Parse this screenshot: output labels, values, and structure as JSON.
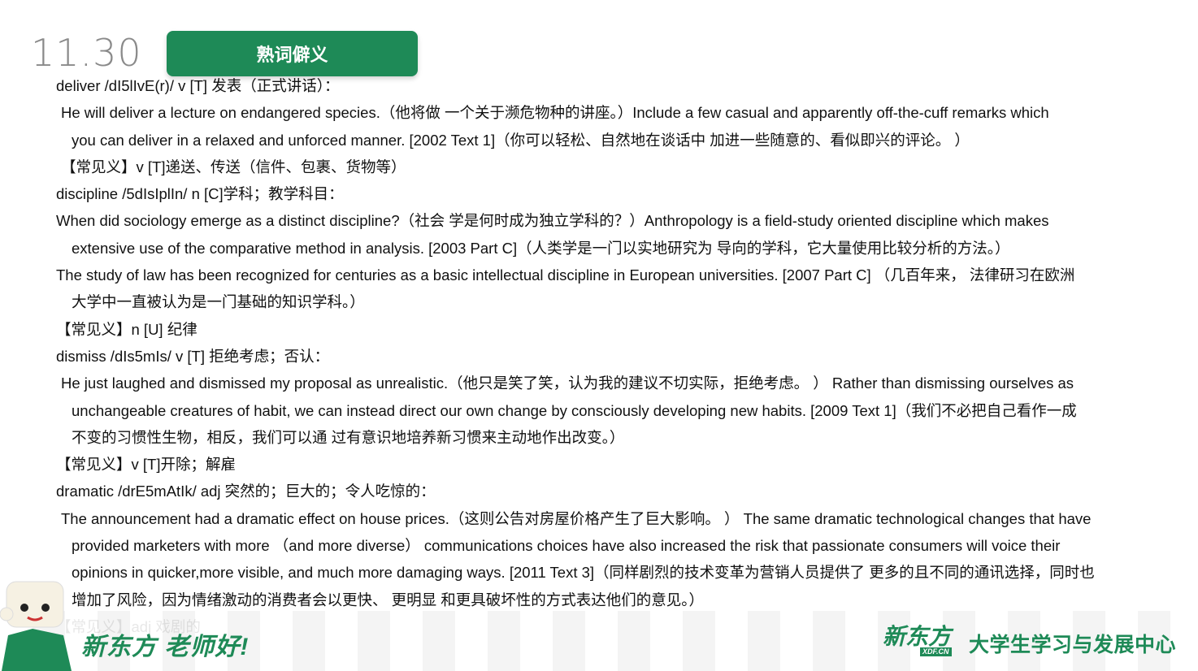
{
  "date": "11.30",
  "tag": "熟词僻义",
  "lines": [
    {
      "text": "deliver /dI5lIvE(r)/ v [T] 发表（正式讲话）：",
      "indent": 0
    },
    {
      "text": "He will deliver a lecture on endangered species.（他将做 一个关于濒危物种的讲座。）Include a few casual and apparently off-the-cuff remarks which",
      "indent": 1
    },
    {
      "text": "you can deliver in a relaxed and unforced manner. [2002 Text 1]（你可以轻松、自然地在谈话中 加进一些随意的、看似即兴的评论。 ）",
      "indent": 2
    },
    {
      "text": "【常见义】v [T]递送、传送（信件、包裹、货物等）",
      "indent": 1
    },
    {
      "text": "discipline /5dIsIplIn/ n [C]学科；教学科目：",
      "indent": 0
    },
    {
      "text": "When did sociology emerge as a distinct discipline?（社会 学是何时成为独立学科的？）Anthropology is a field-study oriented discipline which makes",
      "indent": 0
    },
    {
      "text": "extensive use of the comparative method in analysis. [2003 Part C]（人类学是一门以实地研究为 导向的学科，它大量使用比较分析的方法。）",
      "indent": 2
    },
    {
      "text": "The study of law has been recognized for centuries as a basic intellectual discipline in European universities. [2007 Part C] （几百年来， 法律研习在欧洲",
      "indent": 0
    },
    {
      "text": "大学中一直被认为是一门基础的知识学科。）",
      "indent": 2
    },
    {
      "text": "【常见义】n [U] 纪律",
      "indent": 0
    },
    {
      "text": "dismiss /dIs5mIs/ v [T] 拒绝考虑；否认：",
      "indent": 0
    },
    {
      "text": "He just laughed and dismissed my proposal as unrealistic.（他只是笑了笑，认为我的建议不切实际，拒绝考虑。 ） Rather than dismissing ourselves as",
      "indent": 1
    },
    {
      "text": "unchangeable creatures of habit, we can instead direct our own change by consciously developing new habits. [2009 Text 1]（我们不必把自己看作一成",
      "indent": 2
    },
    {
      "text": "不变的习惯性生物，相反，我们可以通 过有意识地培养新习惯来主动地作出改变。）",
      "indent": 2
    },
    {
      "text": "【常见义】v [T]开除；解雇",
      "indent": 0
    },
    {
      "text": "dramatic /drE5mAtIk/ adj 突然的；巨大的；令人吃惊的：",
      "indent": 0
    },
    {
      "text": "The announcement had a dramatic effect on house prices.（这则公告对房屋价格产生了巨大影响。 ） The same dramatic technological changes that have",
      "indent": 1
    },
    {
      "text": "provided marketers with more （and more diverse） communications choices have also increased the risk that passionate consumers will voice their",
      "indent": 2
    },
    {
      "text": "opinions in quicker,more visible, and much more damaging ways. [2011 Text 3]（同样剧烈的技术变革为营销人员提供了 更多的且不同的通讯选择，同时也",
      "indent": 2
    },
    {
      "text": "增加了风险，因为情绪激动的消费者会以更快、 更明显 和更具破坏性的方式表达他们的意见。）",
      "indent": 2
    },
    {
      "text": "【常见义】adj 戏剧的",
      "indent": 0
    }
  ],
  "footer": {
    "slogan": "新东方 老师好!",
    "logo_cn": "新东方",
    "logo_en": "XDF.CN",
    "center_name": "大学生学习与发展中心"
  },
  "colors": {
    "brand_green": "#1e8a57",
    "date_gray": "#8a8a8a"
  }
}
